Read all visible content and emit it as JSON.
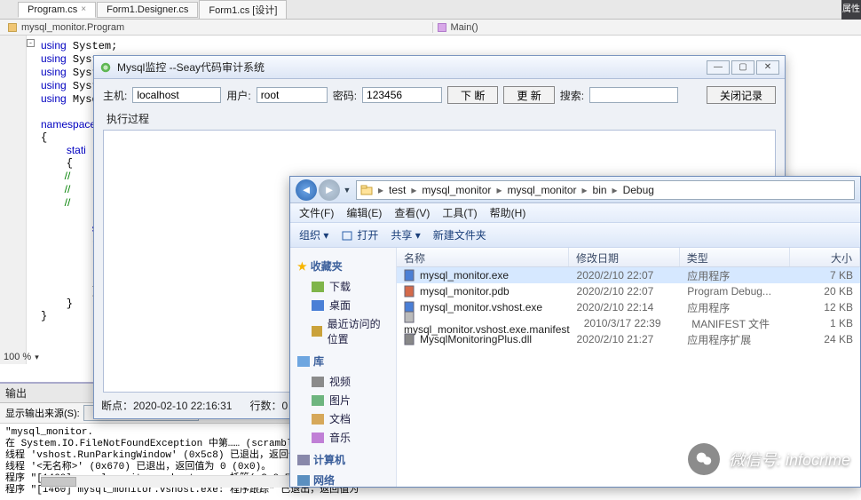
{
  "vs": {
    "tabs": [
      {
        "label": "Program.cs",
        "x": "×"
      },
      {
        "label": "Form1.Designer.cs",
        "x": ""
      },
      {
        "label": "Form1.cs [设计]",
        "x": ""
      }
    ],
    "right_pane": "属性",
    "crumb_left": "mysql_monitor.Program",
    "crumb_right": "Main()",
    "code": "using System;\nusing Syst\nusing Syst\nusing Syst\nusing Mysq\n\nnamespace \n{\n    stati\n    {\n        //\n        //\n        //\n        [S\n        st\n        {\n\n\n\n        }\n    }\n}",
    "zoom": "100 %",
    "output": {
      "title": "输出",
      "source_label": "显示输出来源(S):",
      "text": "\"mysql_monitor.\n在 System.IO.FileNotFoundException 中第…… (scrambled) …… mysqlmonitor\n线程 'vshost.RunParkingWindow' (0x5c8) 已退出，返回值为 0 (0x0)。\n线程 '<无名称>' (0x670) 已退出，返回值为 0 (0x0)。\n程序 \"[1460] mysql_monitor.vshost.exe: 托管(v2.0.50727)\" 已退出，返\n程序 \"[1460] mysql_monitor.vshost.exe: 程序跟踪\" 已退出，返回值为"
    }
  },
  "mysql": {
    "title": "Mysql监控  --Seay代码审计系统",
    "labels": {
      "host": "主机:",
      "user": "用户:",
      "pwd": "密码:",
      "disconnect": "下 断",
      "refresh": "更 新",
      "search": "搜索:",
      "closelog": "关闭记录"
    },
    "host": "localhost",
    "user": "root",
    "pwd": "123456",
    "exec_label": "执行过程",
    "status_breakpoint": "断点：2020-02-10 22:16:31",
    "status_lines": "行数：0"
  },
  "explorer": {
    "path": [
      "test",
      "mysql_monitor",
      "mysql_monitor",
      "bin",
      "Debug"
    ],
    "menu": [
      "文件(F)",
      "编辑(E)",
      "查看(V)",
      "工具(T)",
      "帮助(H)"
    ],
    "toolbar": {
      "org": "组织 ▾",
      "open": "打开",
      "share": "共享 ▾",
      "newfolder": "新建文件夹"
    },
    "side": {
      "fav": "收藏夹",
      "fav_items": [
        "下载",
        "桌面",
        "最近访问的位置"
      ],
      "lib": "库",
      "lib_items": [
        "视频",
        "图片",
        "文档",
        "音乐"
      ],
      "computer": "计算机",
      "network": "网络"
    },
    "columns": [
      "名称",
      "修改日期",
      "类型",
      "大小"
    ],
    "rows": [
      {
        "name": "mysql_monitor.exe",
        "date": "2020/2/10 22:07",
        "type": "应用程序",
        "size": "7 KB",
        "icon": "exe"
      },
      {
        "name": "mysql_monitor.pdb",
        "date": "2020/2/10 22:07",
        "type": "Program Debug...",
        "size": "20 KB",
        "icon": "pdb"
      },
      {
        "name": "mysql_monitor.vshost.exe",
        "date": "2020/2/10 22:14",
        "type": "应用程序",
        "size": "12 KB",
        "icon": "exe"
      },
      {
        "name": "mysql_monitor.vshost.exe.manifest",
        "date": "2010/3/17 22:39",
        "type": "MANIFEST 文件",
        "size": "1 KB",
        "icon": "file"
      },
      {
        "name": "MysqlMonitoringPlus.dll",
        "date": "2020/2/10 21:27",
        "type": "应用程序扩展",
        "size": "24 KB",
        "icon": "dll"
      }
    ]
  },
  "watermark": {
    "label": "微信号",
    "value": "infocrime"
  }
}
